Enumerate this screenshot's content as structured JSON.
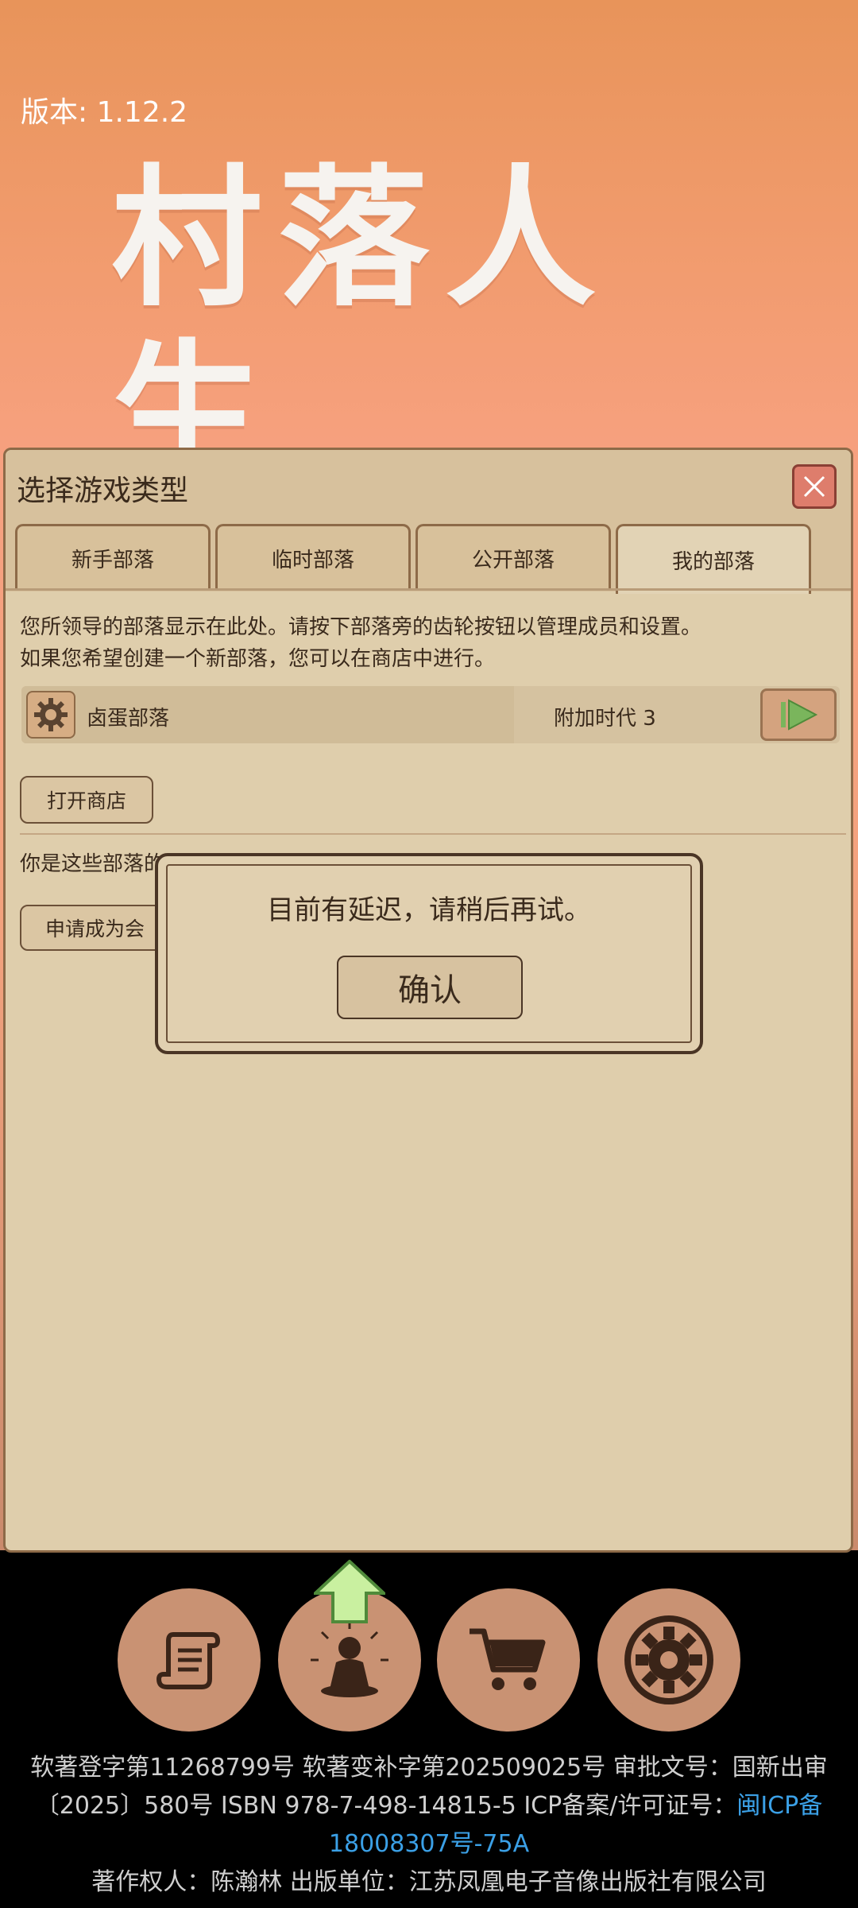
{
  "version_label": "版本: 1.12.2",
  "logo_text": "村落人生",
  "dialog": {
    "title": "选择游戏类型",
    "tabs": [
      {
        "label": "新手部落",
        "active": false
      },
      {
        "label": "临时部落",
        "active": false
      },
      {
        "label": "公开部落",
        "active": false
      },
      {
        "label": "我的部落",
        "active": true
      }
    ],
    "description_line1": "您所领导的部落显示在此处。请按下部落旁的齿轮按钮以管理成员和设置。",
    "description_line2": "如果您希望创建一个新部落，您可以在商店中进行。",
    "tribe": {
      "name": "卤蛋部落",
      "era": "附加时代 3"
    },
    "open_shop_label": "打开商店",
    "member_text": "你是这些部落的",
    "apply_member_label": "申请成为会"
  },
  "alert": {
    "message": "目前有延迟，请稍后再试。",
    "confirm_label": "确认"
  },
  "bottom_nav": [
    {
      "icon": "scroll-icon"
    },
    {
      "icon": "meditation-icon"
    },
    {
      "icon": "cart-icon"
    },
    {
      "icon": "gear-icon"
    }
  ],
  "footer": {
    "line1": "软著登字第11268799号 软著变补字第202509025号 审批文号：国新出审",
    "line2_text": "〔2025〕580号 ISBN 978-7-498-14815-5 ICP备案/许可证号：",
    "line2_link": "闽ICP备",
    "line3_link": "18008307号-75A",
    "line4": "著作权人：陈瀚林 出版单位：江苏凤凰电子音像出版社有限公司"
  },
  "colors": {
    "accent_link": "#3ba0e6",
    "close_red": "#de7d6c",
    "panel_bg": "#dfceac"
  }
}
